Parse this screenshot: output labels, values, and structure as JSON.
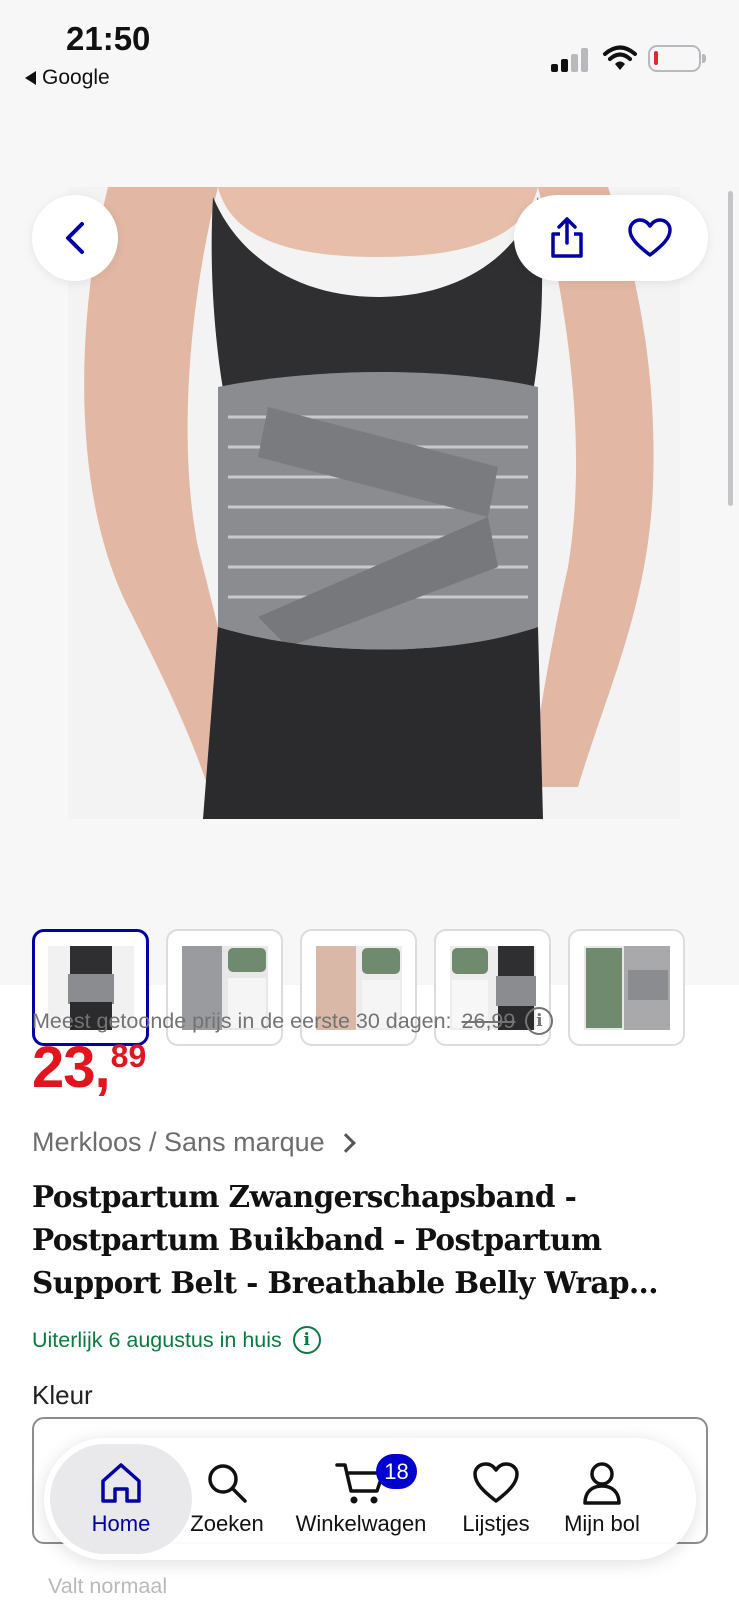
{
  "status_bar": {
    "time": "21:50",
    "back_app": "Google",
    "icons": [
      "signal-icon",
      "wifi-icon",
      "battery-low-icon"
    ]
  },
  "toolbar": {
    "icons": [
      "back-chevron-icon",
      "share-icon",
      "heart-icon"
    ]
  },
  "gallery": {
    "thumbnail_count": 5,
    "selected_index": 0
  },
  "price": {
    "note": "Meest getoonde prijs in de eerste 30 dagen:",
    "old_price": "26,99",
    "euros": "23,",
    "cents": "89"
  },
  "product": {
    "brand": "Merkloos / Sans marque",
    "title_lines": [
      "Postpartum Zwangerschapsband -",
      "Postpartum Buikband - Postpartum",
      "Support Belt - Breathable Belly Wrap..."
    ],
    "delivery": "Uiterlijk 6 augustus in huis",
    "color_label": "Kleur",
    "fit_note": "Valt normaal"
  },
  "nav": {
    "items": [
      {
        "label": "Home",
        "icon": "home-icon"
      },
      {
        "label": "Zoeken",
        "icon": "search-icon"
      },
      {
        "label": "Winkelwagen",
        "icon": "cart-icon"
      },
      {
        "label": "Lijstjes",
        "icon": "heart-icon"
      },
      {
        "label": "Mijn bol",
        "icon": "user-icon"
      }
    ],
    "cart_count": "18"
  },
  "colors": {
    "accent": "#0000a4",
    "price": "#e2141e",
    "delivery": "#0a7a3f"
  }
}
